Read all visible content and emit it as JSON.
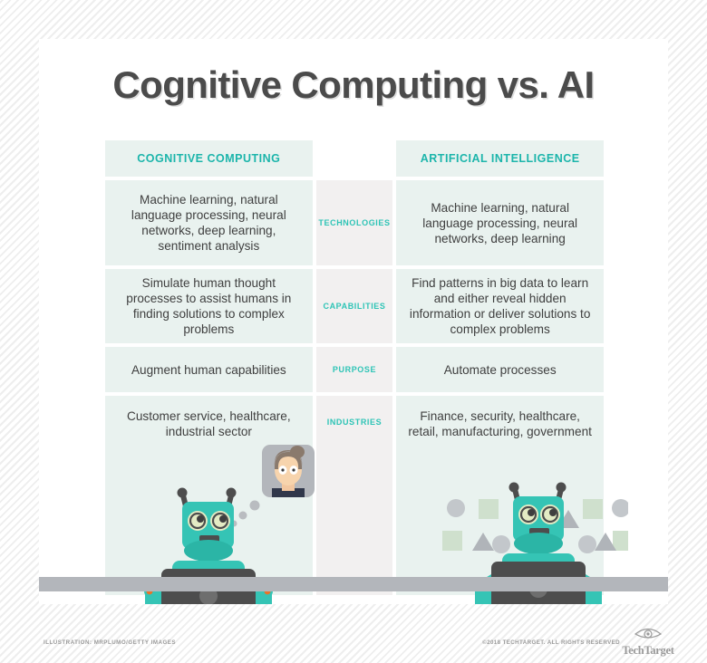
{
  "title": "Cognitive Computing vs. AI",
  "table": {
    "header": {
      "left": "COGNITIVE COMPUTING",
      "middle": "",
      "right": "ARTIFICIAL INTELLIGENCE"
    },
    "rows": [
      {
        "category": "TECHNOLOGIES",
        "left": "Machine learning, natural language processing, neural networks, deep learning, sentiment analysis",
        "right": "Machine learning, natural language processing, neural networks, deep learning"
      },
      {
        "category": "CAPABILITIES",
        "left": "Simulate human thought processes to assist humans in finding solutions to complex problems",
        "right": "Find patterns in big data to learn and either reveal hidden information or deliver solutions to complex problems"
      },
      {
        "category": "PURPOSE",
        "left": "Augment human capabilities",
        "right": "Automate processes"
      },
      {
        "category": "INDUSTRIES",
        "left": "Customer service, healthcare, industrial sector",
        "right": "Finance, security, healthcare, retail, manufacturing, government"
      }
    ]
  },
  "footer": {
    "credit": "ILLUSTRATION: MRPLUMO/GETTY IMAGES",
    "copyright": "©2018 TECHTARGET. ALL RIGHTS RESERVED",
    "logo_text": "TechTarget"
  },
  "colors": {
    "accent_teal": "#1cb5ab",
    "cell_bg": "#e9f2ef",
    "mid_cell_bg": "#f2f0f0",
    "title_gray": "#4b4b4b",
    "robot_body": "#35c4b5",
    "robot_dark": "#4d4d4d",
    "floor_gray": "#b3b6bb"
  },
  "illustrations": {
    "left": "cognitive-robot-thinking-about-person",
    "right": "ai-robot-with-data-shapes"
  }
}
